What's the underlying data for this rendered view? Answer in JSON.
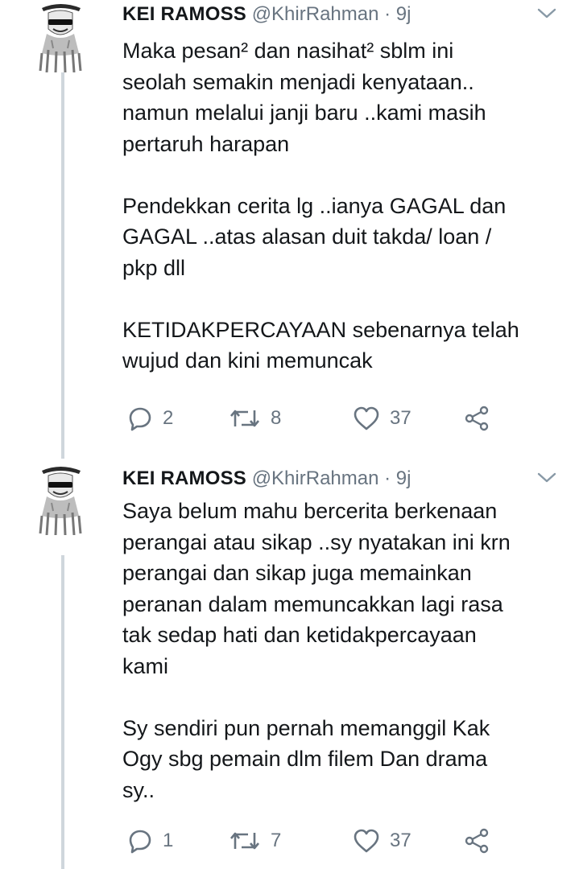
{
  "tweets": [
    {
      "name": "KEI RAMOSS",
      "handle": "@KhirRahman",
      "separator": "·",
      "time": "9j",
      "paragraphs": [
        "Maka pesan² dan nasihat² sblm ini\nseolah semakin menjadi kenyataan..\nnamun melalui janji baru ..kami masih\npertaruh harapan",
        "Pendekkan cerita lg ..ianya GAGAL dan\nGAGAL ..atas alasan duit takda/ loan /\npkp dll",
        "KETIDAKPERCAYAAN sebenarnya telah\nwujud dan kini memuncak"
      ],
      "replies": "2",
      "retweets": "8",
      "likes": "37"
    },
    {
      "name": "KEI RAMOSS",
      "handle": "@KhirRahman",
      "separator": "·",
      "time": "9j",
      "paragraphs": [
        "Saya belum mahu bercerita berkenaan\nperangai atau sikap ..sy nyatakan ini krn\nperangai dan sikap juga memainkan\nperanan dalam memuncakkan lagi rasa\ntak sedap hati dan ketidakpercayaan\nkami",
        "Sy sendiri pun pernah memanggil Kak\nOgy sbg pemain dlm filem Dan drama\nsy.."
      ],
      "replies": "1",
      "retweets": "7",
      "likes": "37"
    }
  ],
  "icons": {
    "reply": "reply-icon",
    "retweet": "retweet-icon",
    "like": "like-icon",
    "share": "share-icon",
    "more": "chevron-down-icon",
    "avatar": "avatar"
  },
  "colors": {
    "text": "#14171a",
    "muted": "#687480",
    "thread_line": "#cfd6dc",
    "background": "#ffffff"
  }
}
